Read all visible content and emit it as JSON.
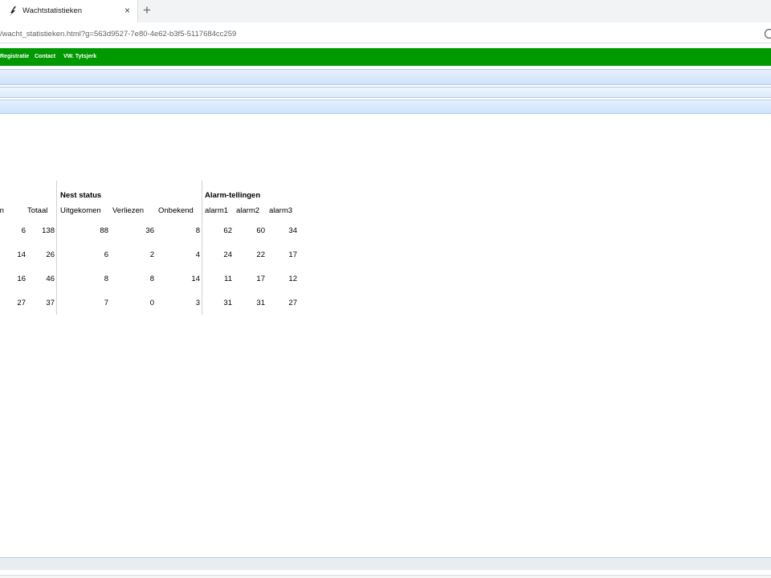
{
  "browser": {
    "tab_title": "Wachtstatistieken",
    "tab_close": "×",
    "new_tab": "+",
    "url": "/wacht_statistieken.html?g=563d9527-7e80-4e62-b3f5-5117684cc259"
  },
  "nav": {
    "items": [
      "Registratie",
      "Contact",
      "VW. Tytsjerk"
    ]
  },
  "table": {
    "groups": {
      "nest_status": "Nest status",
      "alarm": "Alarm-tellingen"
    },
    "columns": [
      "edparen",
      "Totaal",
      "Uitgekomen",
      "Verliezen",
      "Onbekend",
      "alarm1",
      "alarm2",
      "alarm3"
    ],
    "rows": [
      [
        "6",
        "138",
        "88",
        "36",
        "8",
        "62",
        "60",
        "34"
      ],
      [
        "14",
        "26",
        "6",
        "2",
        "4",
        "24",
        "22",
        "17"
      ],
      [
        "16",
        "46",
        "8",
        "8",
        "14",
        "11",
        "17",
        "12"
      ],
      [
        "27",
        "37",
        "7",
        "0",
        "3",
        "31",
        "31",
        "27"
      ]
    ]
  },
  "icons": {
    "tab_favicon": "bird-logo-icon",
    "address_right": "info-icon"
  }
}
